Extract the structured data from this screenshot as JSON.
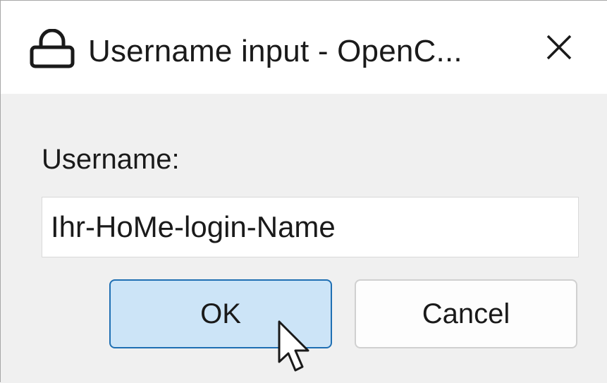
{
  "window": {
    "title": "Username input - OpenC...",
    "title_icon": "lock-icon",
    "close_icon": "close-icon"
  },
  "form": {
    "label": "Username:",
    "username_value": "Ihr-HoMe-login-Name"
  },
  "buttons": {
    "ok_label": "OK",
    "cancel_label": "Cancel"
  },
  "colors": {
    "titlebar_bg": "#ffffff",
    "content_bg": "#f0f0f0",
    "ok_bg": "#cce4f7",
    "ok_border": "#1f6fb3",
    "cancel_border": "#d0d0d0"
  }
}
